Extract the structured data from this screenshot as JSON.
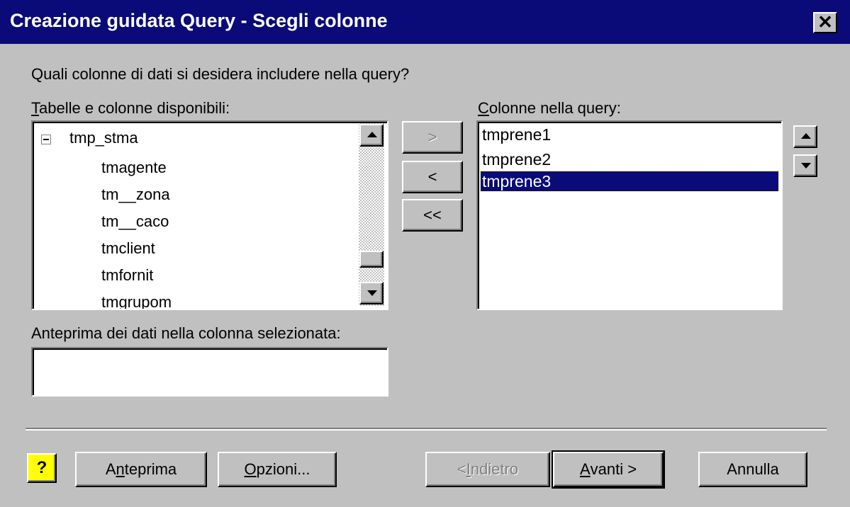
{
  "window": {
    "title": "Creazione guidata Query - Scegli colonne",
    "close_glyph": "✕"
  },
  "prompt": "Quali colonne di dati si desidera includere nella query?",
  "available": {
    "label": "Tabelle e colonne disponibili:",
    "label_mnemonic": "T",
    "label_rest": "abelle e colonne disponibili:",
    "table_name": "tmp_stma",
    "expand_glyph": "−",
    "columns": [
      "tmagente",
      "tm__zona",
      "tm__caco",
      "tmclient",
      "tmfornit",
      "tmgrupom"
    ]
  },
  "move_buttons": {
    "add": ">",
    "remove": "<",
    "remove_all": "<<"
  },
  "query_columns": {
    "label": "Colonne nella query:",
    "label_mnemonic": "C",
    "label_rest": "olonne nella query:",
    "items": [
      "tmprene1",
      "tmprene2",
      "tmprene3"
    ],
    "selected_index": 2
  },
  "preview": {
    "label": "Anteprima dei dati nella colonna selezionata:",
    "value": ""
  },
  "buttons": {
    "help": "?",
    "anteprima_pre": "A",
    "anteprima_mn": "n",
    "anteprima_post": "teprima",
    "opzioni_mn": "O",
    "opzioni_post": "pzioni...",
    "indietro_pre": "< ",
    "indietro_mn": "I",
    "indietro_post": "ndietro",
    "avanti_mn": "A",
    "avanti_post": "vanti >",
    "annulla": "Annulla"
  },
  "colors": {
    "title_bar": "#0a0a78",
    "face": "#c0c0c0",
    "selection": "#0a0a78"
  }
}
